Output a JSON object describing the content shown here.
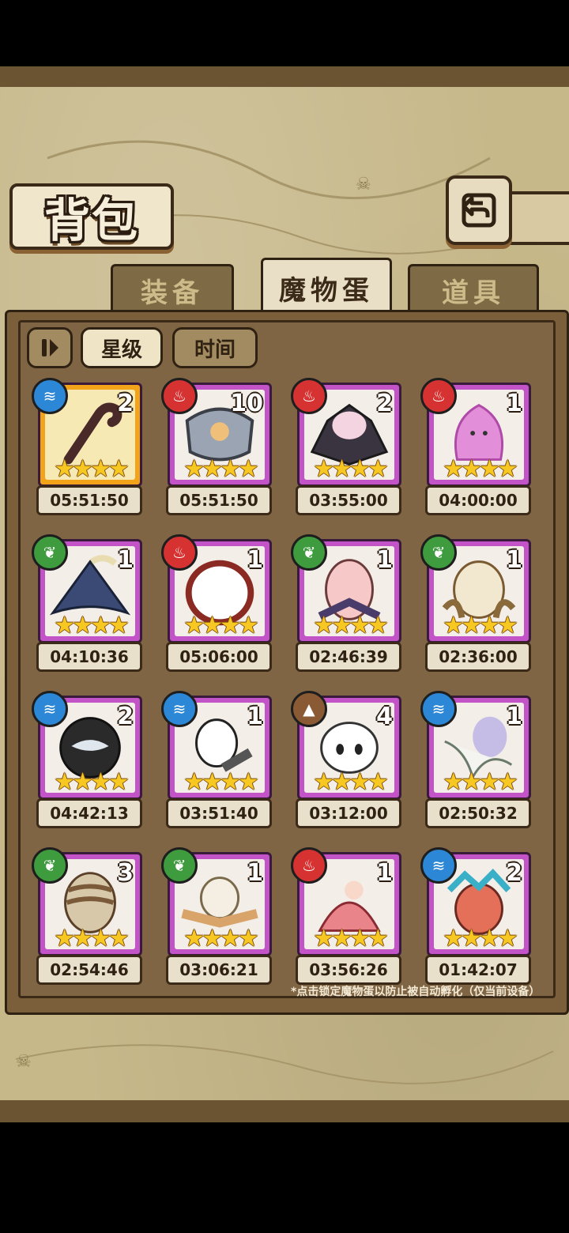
{
  "header": {
    "title": "背包"
  },
  "tabs": [
    {
      "label": "装备",
      "active": false
    },
    {
      "label": "魔物蛋",
      "active": true
    },
    {
      "label": "道具",
      "active": false
    }
  ],
  "controls": {
    "lock_icon": "lock-toggle-icon",
    "sort_star": "星级",
    "sort_time": "时间"
  },
  "eggs": [
    {
      "element": "water",
      "count": "2",
      "time": "05:51:50",
      "icon": "staff-egg-icon"
    },
    {
      "element": "fire",
      "count": "10",
      "time": "05:51:50",
      "icon": "shield-egg-icon"
    },
    {
      "element": "fire",
      "count": "2",
      "time": "03:55:00",
      "icon": "bat-egg-icon"
    },
    {
      "element": "fire",
      "count": "1",
      "time": "04:00:00",
      "icon": "pink-ghost-egg-icon"
    },
    {
      "element": "grass",
      "count": "1",
      "time": "04:10:36",
      "icon": "witch-hat-egg-icon"
    },
    {
      "element": "fire",
      "count": "1",
      "time": "05:06:00",
      "icon": "hood-egg-icon"
    },
    {
      "element": "grass",
      "count": "1",
      "time": "02:46:39",
      "icon": "pink-egg-icon"
    },
    {
      "element": "grass",
      "count": "1",
      "time": "02:36:00",
      "icon": "cream-egg-icon"
    },
    {
      "element": "water",
      "count": "2",
      "time": "04:42:13",
      "icon": "black-orb-egg-icon"
    },
    {
      "element": "water",
      "count": "1",
      "time": "03:51:40",
      "icon": "panda-gun-egg-icon"
    },
    {
      "element": "earth",
      "count": "4",
      "time": "03:12:00",
      "icon": "cracked-skull-egg-icon"
    },
    {
      "element": "water",
      "count": "1",
      "time": "02:50:32",
      "icon": "white-lily-egg-icon"
    },
    {
      "element": "grass",
      "count": "3",
      "time": "02:54:46",
      "icon": "striped-egg-icon"
    },
    {
      "element": "grass",
      "count": "1",
      "time": "03:06:21",
      "icon": "feather-egg-icon"
    },
    {
      "element": "fire",
      "count": "1",
      "time": "03:56:26",
      "icon": "kimono-egg-icon"
    },
    {
      "element": "water",
      "count": "2",
      "time": "01:42:07",
      "icon": "feather-crown-egg-icon"
    }
  ],
  "stars": "★★★★",
  "footer_note": "*点击锁定魔物蛋以防止被自动孵化（仅当前设备）",
  "colors": {
    "frame_purple": "#c254c8",
    "frame_gold": "#f2a31a",
    "water": "#2c87d6",
    "fire": "#d63232",
    "grass": "#3e9b3e",
    "earth": "#8a5a34"
  }
}
